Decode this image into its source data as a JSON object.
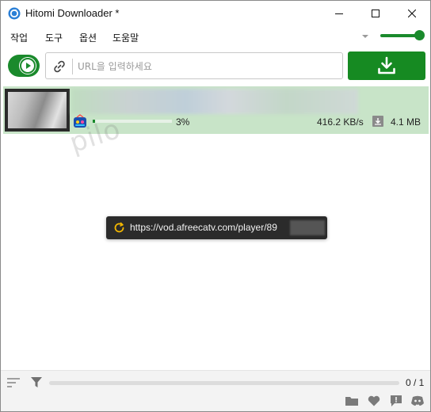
{
  "window": {
    "title": "Hitomi Downloader *",
    "accent_color": "#1a8a2c",
    "app_icon": "hitomi-app-icon",
    "controls": [
      "minimize-icon",
      "maximize-icon",
      "close-icon"
    ]
  },
  "menu": {
    "items": [
      {
        "label": "작업"
      },
      {
        "label": "도구"
      },
      {
        "label": "옵션"
      },
      {
        "label": "도움말"
      }
    ],
    "caret_icon": "chevron-down-icon"
  },
  "volume": {
    "level": 0.9
  },
  "toolbar": {
    "toggle_icon": "play-icon",
    "toggle_on": true,
    "url_placeholder": "URL을 입력하세요",
    "url_value": "",
    "link_icon": "link-icon",
    "download_icon": "download-icon"
  },
  "tasks": [
    {
      "site_icon": "afreecatv-icon",
      "progress": 0.03,
      "percent": "3%",
      "speed": "416.2 KB/s",
      "size": "4.1 MB"
    }
  ],
  "watermark": "pilo",
  "tooltip": {
    "icon": "refresh-icon",
    "text": "https://vod.afreecatv.com/player/89"
  },
  "status": {
    "count": "0 / 1",
    "icons": [
      "folder-icon",
      "heart-icon",
      "feedback-icon",
      "discord-icon"
    ]
  }
}
